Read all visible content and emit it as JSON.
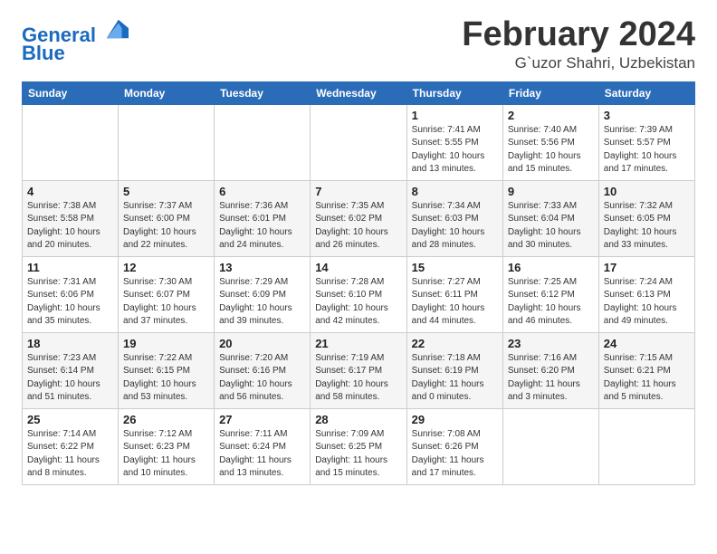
{
  "header": {
    "logo_line1": "General",
    "logo_line2": "Blue",
    "month": "February 2024",
    "location": "G`uzor Shahri, Uzbekistan"
  },
  "weekdays": [
    "Sunday",
    "Monday",
    "Tuesday",
    "Wednesday",
    "Thursday",
    "Friday",
    "Saturday"
  ],
  "weeks": [
    [
      {
        "day": "",
        "info": ""
      },
      {
        "day": "",
        "info": ""
      },
      {
        "day": "",
        "info": ""
      },
      {
        "day": "",
        "info": ""
      },
      {
        "day": "1",
        "info": "Sunrise: 7:41 AM\nSunset: 5:55 PM\nDaylight: 10 hours\nand 13 minutes."
      },
      {
        "day": "2",
        "info": "Sunrise: 7:40 AM\nSunset: 5:56 PM\nDaylight: 10 hours\nand 15 minutes."
      },
      {
        "day": "3",
        "info": "Sunrise: 7:39 AM\nSunset: 5:57 PM\nDaylight: 10 hours\nand 17 minutes."
      }
    ],
    [
      {
        "day": "4",
        "info": "Sunrise: 7:38 AM\nSunset: 5:58 PM\nDaylight: 10 hours\nand 20 minutes."
      },
      {
        "day": "5",
        "info": "Sunrise: 7:37 AM\nSunset: 6:00 PM\nDaylight: 10 hours\nand 22 minutes."
      },
      {
        "day": "6",
        "info": "Sunrise: 7:36 AM\nSunset: 6:01 PM\nDaylight: 10 hours\nand 24 minutes."
      },
      {
        "day": "7",
        "info": "Sunrise: 7:35 AM\nSunset: 6:02 PM\nDaylight: 10 hours\nand 26 minutes."
      },
      {
        "day": "8",
        "info": "Sunrise: 7:34 AM\nSunset: 6:03 PM\nDaylight: 10 hours\nand 28 minutes."
      },
      {
        "day": "9",
        "info": "Sunrise: 7:33 AM\nSunset: 6:04 PM\nDaylight: 10 hours\nand 30 minutes."
      },
      {
        "day": "10",
        "info": "Sunrise: 7:32 AM\nSunset: 6:05 PM\nDaylight: 10 hours\nand 33 minutes."
      }
    ],
    [
      {
        "day": "11",
        "info": "Sunrise: 7:31 AM\nSunset: 6:06 PM\nDaylight: 10 hours\nand 35 minutes."
      },
      {
        "day": "12",
        "info": "Sunrise: 7:30 AM\nSunset: 6:07 PM\nDaylight: 10 hours\nand 37 minutes."
      },
      {
        "day": "13",
        "info": "Sunrise: 7:29 AM\nSunset: 6:09 PM\nDaylight: 10 hours\nand 39 minutes."
      },
      {
        "day": "14",
        "info": "Sunrise: 7:28 AM\nSunset: 6:10 PM\nDaylight: 10 hours\nand 42 minutes."
      },
      {
        "day": "15",
        "info": "Sunrise: 7:27 AM\nSunset: 6:11 PM\nDaylight: 10 hours\nand 44 minutes."
      },
      {
        "day": "16",
        "info": "Sunrise: 7:25 AM\nSunset: 6:12 PM\nDaylight: 10 hours\nand 46 minutes."
      },
      {
        "day": "17",
        "info": "Sunrise: 7:24 AM\nSunset: 6:13 PM\nDaylight: 10 hours\nand 49 minutes."
      }
    ],
    [
      {
        "day": "18",
        "info": "Sunrise: 7:23 AM\nSunset: 6:14 PM\nDaylight: 10 hours\nand 51 minutes."
      },
      {
        "day": "19",
        "info": "Sunrise: 7:22 AM\nSunset: 6:15 PM\nDaylight: 10 hours\nand 53 minutes."
      },
      {
        "day": "20",
        "info": "Sunrise: 7:20 AM\nSunset: 6:16 PM\nDaylight: 10 hours\nand 56 minutes."
      },
      {
        "day": "21",
        "info": "Sunrise: 7:19 AM\nSunset: 6:17 PM\nDaylight: 10 hours\nand 58 minutes."
      },
      {
        "day": "22",
        "info": "Sunrise: 7:18 AM\nSunset: 6:19 PM\nDaylight: 11 hours\nand 0 minutes."
      },
      {
        "day": "23",
        "info": "Sunrise: 7:16 AM\nSunset: 6:20 PM\nDaylight: 11 hours\nand 3 minutes."
      },
      {
        "day": "24",
        "info": "Sunrise: 7:15 AM\nSunset: 6:21 PM\nDaylight: 11 hours\nand 5 minutes."
      }
    ],
    [
      {
        "day": "25",
        "info": "Sunrise: 7:14 AM\nSunset: 6:22 PM\nDaylight: 11 hours\nand 8 minutes."
      },
      {
        "day": "26",
        "info": "Sunrise: 7:12 AM\nSunset: 6:23 PM\nDaylight: 11 hours\nand 10 minutes."
      },
      {
        "day": "27",
        "info": "Sunrise: 7:11 AM\nSunset: 6:24 PM\nDaylight: 11 hours\nand 13 minutes."
      },
      {
        "day": "28",
        "info": "Sunrise: 7:09 AM\nSunset: 6:25 PM\nDaylight: 11 hours\nand 15 minutes."
      },
      {
        "day": "29",
        "info": "Sunrise: 7:08 AM\nSunset: 6:26 PM\nDaylight: 11 hours\nand 17 minutes."
      },
      {
        "day": "",
        "info": ""
      },
      {
        "day": "",
        "info": ""
      }
    ]
  ]
}
